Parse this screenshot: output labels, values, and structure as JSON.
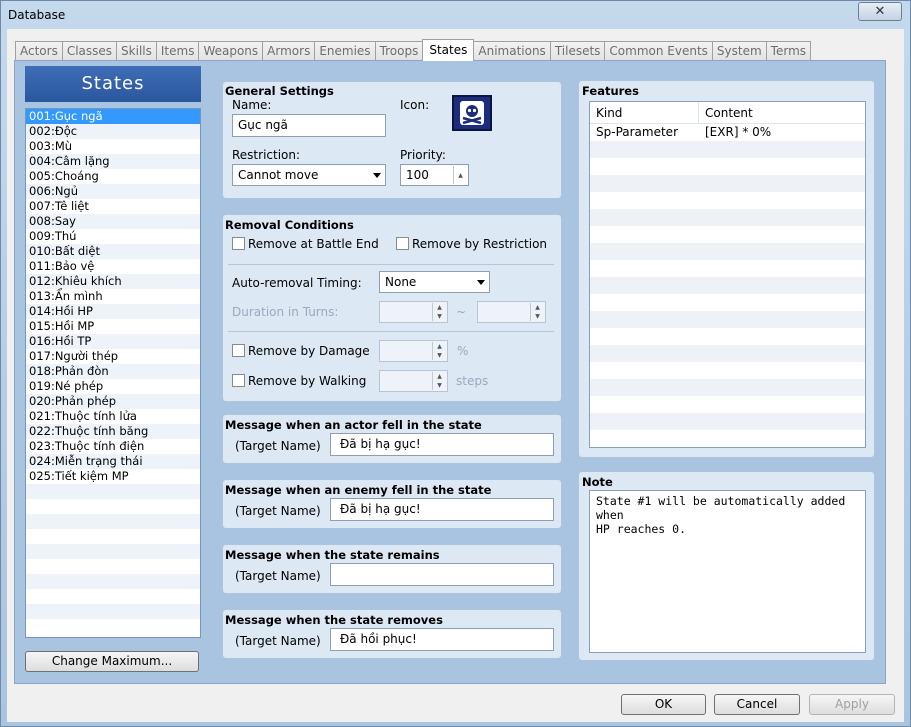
{
  "window": {
    "title": "Database"
  },
  "tabs": [
    "Actors",
    "Classes",
    "Skills",
    "Items",
    "Weapons",
    "Armors",
    "Enemies",
    "Troops",
    "States",
    "Animations",
    "Tilesets",
    "Common Events",
    "System",
    "Terms"
  ],
  "active_tab": "States",
  "left": {
    "header": "States",
    "items": [
      "001:Gục ngã",
      "002:Độc",
      "003:Mù",
      "004:Câm lặng",
      "005:Choáng",
      "006:Ngủ",
      "007:Tê liệt",
      "008:Say",
      "009:Thú",
      "010:Bất diệt",
      "011:Bảo vệ",
      "012:Khiêu khích",
      "013:Ẩn mình",
      "014:Hồi HP",
      "015:Hồi MP",
      "016:Hồi TP",
      "017:Người thép",
      "018:Phản đòn",
      "019:Né phép",
      "020:Phản phép",
      "021:Thuộc tính lửa",
      "022:Thuộc tính băng",
      "023:Thuộc tính điện",
      "024:Miễn trạng thái",
      "025:Tiết kiệm MP"
    ],
    "change_max_label": "Change Maximum..."
  },
  "general": {
    "title": "General Settings",
    "name_label": "Name:",
    "name_value": "Gục ngã",
    "icon_label": "Icon:",
    "icon_name": "skull-icon",
    "restriction_label": "Restriction:",
    "restriction_value": "Cannot move",
    "priority_label": "Priority:",
    "priority_value": "100"
  },
  "removal": {
    "title": "Removal Conditions",
    "battle_end_label": "Remove at Battle End",
    "by_restriction_label": "Remove by Restriction",
    "timing_label": "Auto-removal Timing:",
    "timing_value": "None",
    "duration_label": "Duration in Turns:",
    "tilde": "~",
    "by_damage_label": "Remove by Damage",
    "percent": "%",
    "by_walking_label": "Remove by Walking",
    "steps": "steps"
  },
  "messages": [
    {
      "title": "Message when an actor fell in the state",
      "label": "(Target Name)",
      "value": "Đã bị hạ gục!"
    },
    {
      "title": "Message when an enemy fell in the state",
      "label": "(Target Name)",
      "value": "Đã bị hạ gục!"
    },
    {
      "title": "Message when the state remains",
      "label": "(Target Name)",
      "value": ""
    },
    {
      "title": "Message when the state removes",
      "label": "(Target Name)",
      "value": "Đã hồi phục!"
    }
  ],
  "features": {
    "title": "Features",
    "col_kind": "Kind",
    "col_content": "Content",
    "rows": [
      {
        "kind": "Sp-Parameter",
        "content": "[EXR] * 0%"
      }
    ]
  },
  "note": {
    "title": "Note",
    "text": "State #1 will be automatically added when\nHP reaches 0."
  },
  "buttons": {
    "ok": "OK",
    "cancel": "Cancel",
    "apply": "Apply"
  }
}
